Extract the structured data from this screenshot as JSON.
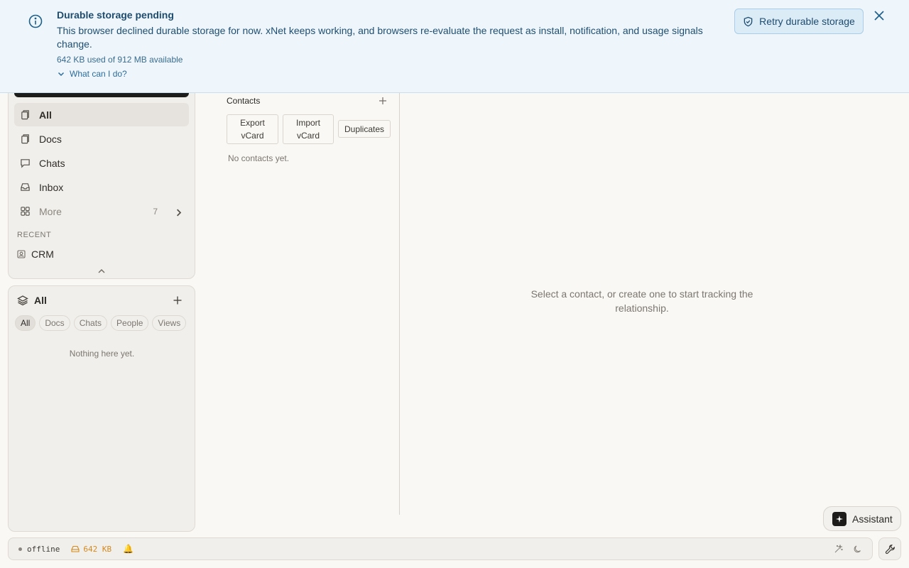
{
  "banner": {
    "title": "Durable storage pending",
    "body": "This browser declined durable storage for now. xNet keeps working, and browsers re-evaluate the request as install, notification, and usage signals change.",
    "usage": "642 KB used of 912 MB available",
    "help_label": "What can I do?",
    "retry_label": "Retry durable storage",
    "icon": "info-icon",
    "accent_color": "#1e4c6f"
  },
  "sidebar": {
    "nav": [
      {
        "label": "All",
        "icon": "files-icon"
      },
      {
        "label": "Docs",
        "icon": "doc-icon"
      },
      {
        "label": "Chats",
        "icon": "chat-icon"
      },
      {
        "label": "Inbox",
        "icon": "inbox-icon"
      }
    ],
    "more": {
      "label": "More",
      "count": "7"
    },
    "recent_label": "RECENT",
    "recent_items": [
      {
        "label": "CRM",
        "icon": "contact-icon"
      }
    ]
  },
  "library": {
    "title": "All",
    "filters": [
      "All",
      "Docs",
      "Chats",
      "People",
      "Views"
    ],
    "empty_text": "Nothing here yet."
  },
  "contacts": {
    "title": "Contacts",
    "export_label": "Export vCard",
    "import_label": "Import vCard",
    "duplicates_label": "Duplicates",
    "empty_text": "No contacts yet."
  },
  "main": {
    "placeholder": "Select a contact, or create one to start tracking the relationship."
  },
  "assistant": {
    "label": "Assistant"
  },
  "statusbar": {
    "connection": "offline",
    "storage": "642 KB",
    "bell": "🔔",
    "warning_color": "#d58a1c"
  }
}
